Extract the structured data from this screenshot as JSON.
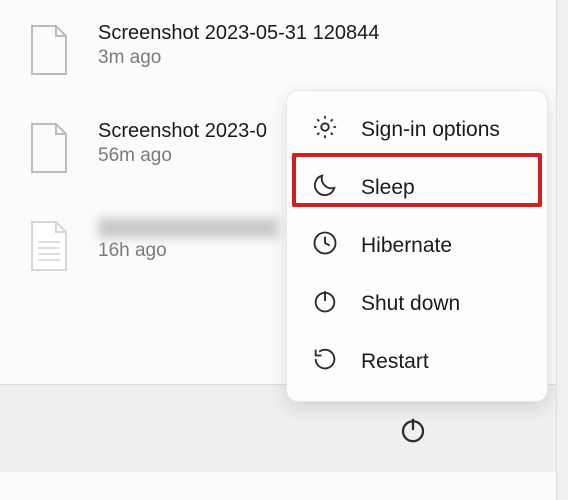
{
  "files": [
    {
      "name": "Screenshot 2023-05-31 120844",
      "time": "3m ago",
      "type": "blank"
    },
    {
      "name": "Screenshot 2023-0",
      "time": "56m ago",
      "type": "blank"
    },
    {
      "name": "",
      "time": "16h ago",
      "type": "text",
      "redacted": true
    }
  ],
  "power_menu": {
    "items": [
      {
        "key": "signin",
        "label": "Sign-in options",
        "icon": "gear-icon"
      },
      {
        "key": "sleep",
        "label": "Sleep",
        "icon": "moon-icon",
        "highlighted": true
      },
      {
        "key": "hibernate",
        "label": "Hibernate",
        "icon": "clock-icon"
      },
      {
        "key": "shutdown",
        "label": "Shut down",
        "icon": "power-icon"
      },
      {
        "key": "restart",
        "label": "Restart",
        "icon": "restart-icon"
      }
    ]
  },
  "highlight_color": "#d3201f"
}
